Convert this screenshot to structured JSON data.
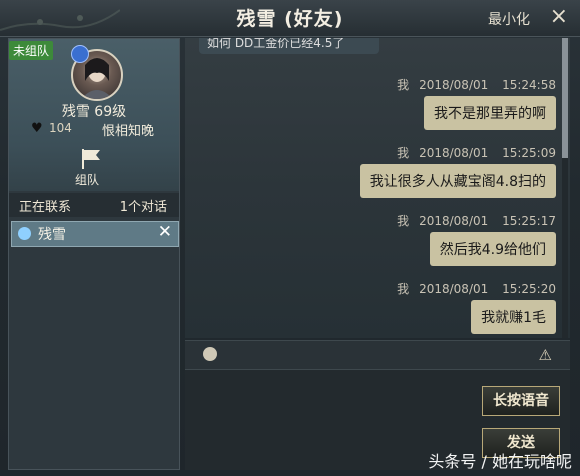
{
  "window": {
    "title": "残雪 (好友)",
    "minimize_label": "最小化",
    "close_symbol": "×"
  },
  "profile": {
    "team_status": "未组队",
    "name_level": "残雪  69级",
    "favor": "104",
    "relation": "恨相知晚",
    "team_action": "组队"
  },
  "contacts": {
    "header_left": "正在联系",
    "header_right": "1个对话",
    "items": [
      {
        "name": "残雪"
      }
    ]
  },
  "chat": {
    "top_partial": "如何 DD工金价已经4.5了",
    "messages": [
      {
        "sender": "我",
        "date": "2018/08/01",
        "time": "15:24:58",
        "text": "我不是那里弄的啊"
      },
      {
        "sender": "我",
        "date": "2018/08/01",
        "time": "15:25:09",
        "text": "我让很多人从藏宝阁4.8扫的"
      },
      {
        "sender": "我",
        "date": "2018/08/01",
        "time": "15:25:17",
        "text": "然后我4.9给他们"
      },
      {
        "sender": "我",
        "date": "2018/08/01",
        "time": "15:25:20",
        "text": "我就赚1毛"
      }
    ]
  },
  "compose": {
    "voice_button": "长按语音",
    "send_button": "发送"
  },
  "watermark": "头条号 / 她在玩啥呢",
  "colors": {
    "bubble": "#c9c2a2",
    "panel": "#2e383e",
    "accent_green": "#3d8a3a"
  }
}
